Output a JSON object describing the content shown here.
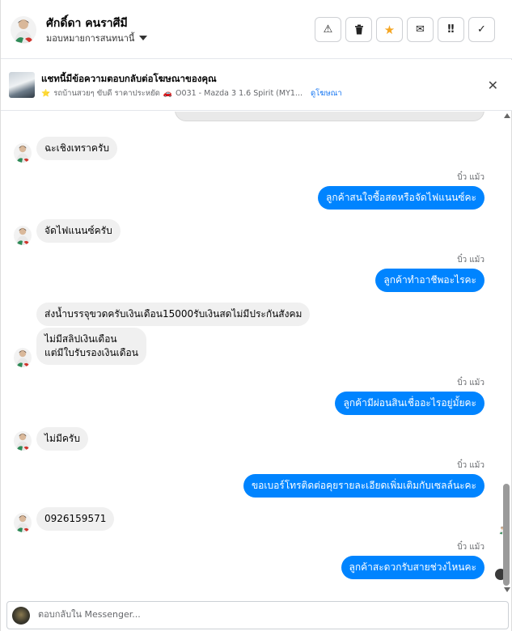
{
  "header": {
    "name": "ศักดิ์ดา คนราศีมี",
    "assign_label": "มอบหมายการสนทนานี้",
    "actions": [
      {
        "icon": "warning-icon",
        "glyph": "⚠"
      },
      {
        "icon": "trash-icon",
        "glyph": "🗑"
      },
      {
        "icon": "star-icon",
        "glyph": "★",
        "color": "#f5a623"
      },
      {
        "icon": "mail-icon",
        "glyph": "✉"
      },
      {
        "icon": "priority-icon",
        "glyph": "‼"
      },
      {
        "icon": "check-icon",
        "glyph": "✓"
      }
    ]
  },
  "banner": {
    "title": "แชทนี้มีข้อความตอบกลับต่อโฆษณาของคุณ",
    "star_glyph": "⭐",
    "car_glyph": "🚗",
    "ad_text_1": "รถบ้านสวยๆ ขับดี ราคาประหยัด",
    "ad_text_2": "O031 - Mazda 3 1.6 Spirit (MY1...",
    "link_label": "ดูโฆษณา",
    "close_glyph": "✕"
  },
  "messages": [
    {
      "side": "in",
      "text": "ฉะเชิงเทราครับ"
    },
    {
      "side": "out",
      "sender": "บิ๋ว แม้ว",
      "text": "ลูกค้าสนใจซื้อสดหรือจัดไฟแนนซ์คะ"
    },
    {
      "side": "in",
      "text": "จัดไฟแนนซ์ครับ"
    },
    {
      "side": "out",
      "sender": "บิ๋ว แม้ว",
      "text": "ลูกค้าทำอาชีพอะไรคะ"
    },
    {
      "side": "in",
      "text": "ส่งน้ำบรรจุขวดครับเงินเดือน15000รับเงินสดไม่มีประกันสังคม"
    },
    {
      "side": "in",
      "text": "ไม่มีสลิปเงินเดือน\nแต่มีใบรับรองเงินเดือน"
    },
    {
      "side": "out",
      "sender": "บิ๋ว แม้ว",
      "text": "ลูกค้ามีผ่อนสินเชื่ออะไรอยู่มั้ยคะ"
    },
    {
      "side": "in",
      "text": "ไม่มีครับ"
    },
    {
      "side": "out",
      "sender": "บิ๋ว แม้ว",
      "text": "ขอเบอร์โทรติดต่อคุยรายละเอียดเพิ่มเติมกับเซลล์นะคะ"
    },
    {
      "side": "in",
      "text": "0926159571"
    },
    {
      "side": "out",
      "sender": "บิ๋ว แม้ว",
      "text": "ลูกค้าสะดวกรับสายช่วงไหนคะ"
    }
  ],
  "reply": {
    "placeholder": "ตอบกลับใน Messenger..."
  },
  "colors": {
    "outgoing_bubble": "#0084ff",
    "incoming_bubble": "#f0f0f0",
    "link": "#1877f2"
  }
}
